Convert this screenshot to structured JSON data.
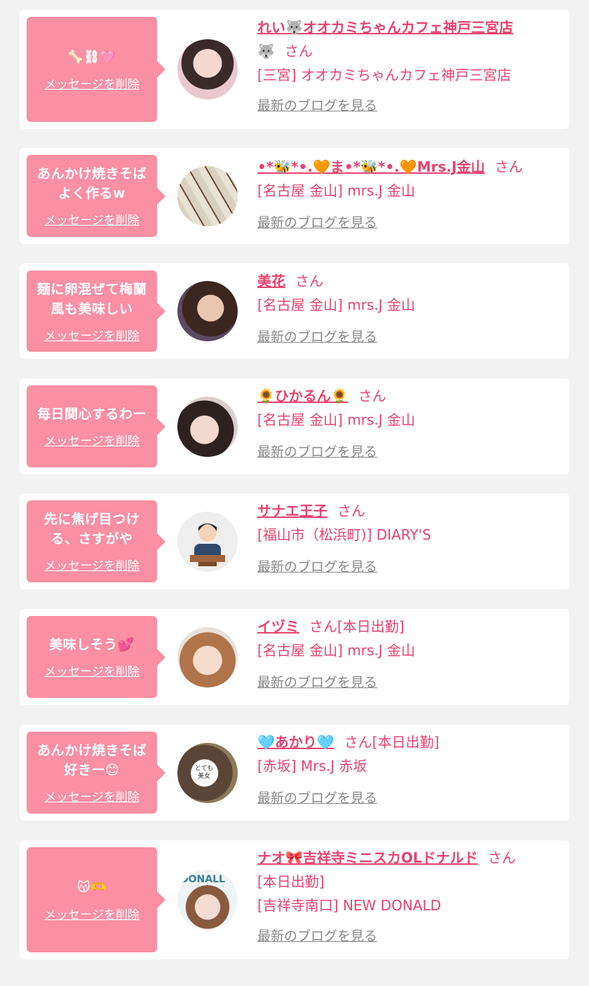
{
  "delete_label": "メッセージを削除",
  "blog_label": "最新のブログを見る",
  "cards": [
    {
      "message": "🦴⛓🩷",
      "name": "れい🐺オオカミちゃんカフェ神戸三宮店",
      "name_suffix": "🐺",
      "san": "さん",
      "shop": "[三宮] オオカミちゃんカフェ神戸三宮店"
    },
    {
      "message": "あんかけ焼きそば\nよく作るw",
      "name": "•*🐝*•.🧡ま•*🐝*•.🧡Mrs.J金山",
      "san": "さん",
      "shop": "[名古屋 金山] mrs.J 金山"
    },
    {
      "message": "麺に卵混ぜて梅蘭\n風も美味しい",
      "name": "美花",
      "san": "さん",
      "shop": "[名古屋 金山] mrs.J 金山"
    },
    {
      "message": "毎日関心するわー",
      "name": "🌻ひかるん🌻",
      "san": "さん",
      "shop": "[名古屋 金山] mrs.J 金山"
    },
    {
      "message": "先に焦げ目つけ\nる、さすがや",
      "name": "サナエ王子",
      "san": "さん",
      "shop": "[福山市（松浜町)] DIARY'S"
    },
    {
      "message": "美味しそう💕",
      "name": "イヅミ",
      "san": "さん[本日出勤]",
      "shop": "[名古屋 金山] mrs.J 金山"
    },
    {
      "message": "あんかけ焼きそば\n好きー😊",
      "name": "🩵あかり🩵",
      "san": "さん[本日出勤]",
      "shop": "[赤坂] Mrs.J 赤坂",
      "avatar_text": "とても美女"
    },
    {
      "message": "😽🫶",
      "name": "ナオ🎀吉祥寺ミニスカOLドナルド",
      "san": "さん",
      "shift": "[本日出勤]",
      "shop": "[吉祥寺南口] NEW DONALD",
      "avatar_text": "DONALL"
    }
  ],
  "colors": {
    "accent": "#e8436e",
    "bubble": "#fb8fa3",
    "muted": "#888888"
  }
}
